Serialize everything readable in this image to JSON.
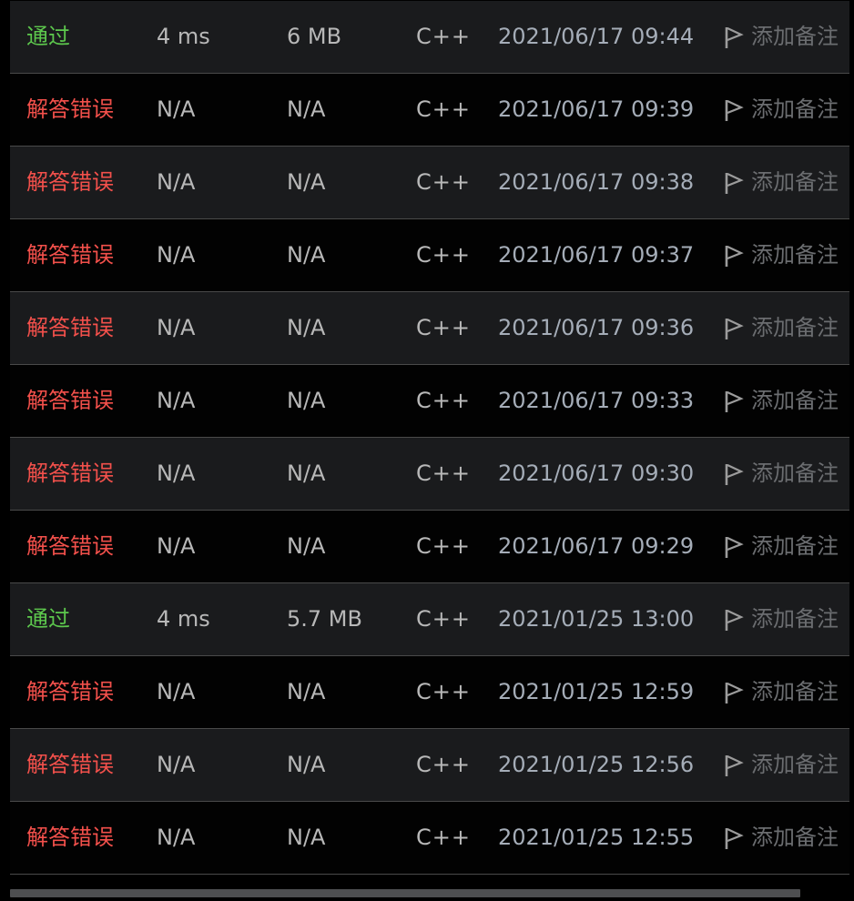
{
  "submissions": [
    {
      "status": "通过",
      "result": "pass",
      "runtime": "4 ms",
      "memory": "6 MB",
      "language": "C++",
      "time": "2021/06/17 09:44",
      "note": "添加备注"
    },
    {
      "status": "解答错误",
      "result": "fail",
      "runtime": "N/A",
      "memory": "N/A",
      "language": "C++",
      "time": "2021/06/17 09:39",
      "note": "添加备注"
    },
    {
      "status": "解答错误",
      "result": "fail",
      "runtime": "N/A",
      "memory": "N/A",
      "language": "C++",
      "time": "2021/06/17 09:38",
      "note": "添加备注"
    },
    {
      "status": "解答错误",
      "result": "fail",
      "runtime": "N/A",
      "memory": "N/A",
      "language": "C++",
      "time": "2021/06/17 09:37",
      "note": "添加备注"
    },
    {
      "status": "解答错误",
      "result": "fail",
      "runtime": "N/A",
      "memory": "N/A",
      "language": "C++",
      "time": "2021/06/17 09:36",
      "note": "添加备注"
    },
    {
      "status": "解答错误",
      "result": "fail",
      "runtime": "N/A",
      "memory": "N/A",
      "language": "C++",
      "time": "2021/06/17 09:33",
      "note": "添加备注"
    },
    {
      "status": "解答错误",
      "result": "fail",
      "runtime": "N/A",
      "memory": "N/A",
      "language": "C++",
      "time": "2021/06/17 09:30",
      "note": "添加备注"
    },
    {
      "status": "解答错误",
      "result": "fail",
      "runtime": "N/A",
      "memory": "N/A",
      "language": "C++",
      "time": "2021/06/17 09:29",
      "note": "添加备注"
    },
    {
      "status": "通过",
      "result": "pass",
      "runtime": "4 ms",
      "memory": "5.7 MB",
      "language": "C++",
      "time": "2021/01/25 13:00",
      "note": "添加备注"
    },
    {
      "status": "解答错误",
      "result": "fail",
      "runtime": "N/A",
      "memory": "N/A",
      "language": "C++",
      "time": "2021/01/25 12:59",
      "note": "添加备注"
    },
    {
      "status": "解答错误",
      "result": "fail",
      "runtime": "N/A",
      "memory": "N/A",
      "language": "C++",
      "time": "2021/01/25 12:56",
      "note": "添加备注"
    },
    {
      "status": "解答错误",
      "result": "fail",
      "runtime": "N/A",
      "memory": "N/A",
      "language": "C++",
      "time": "2021/01/25 12:55",
      "note": "添加备注"
    }
  ],
  "colors": {
    "pass": "#5dc84d",
    "fail": "#f2504b",
    "row_dark": "#1a1b1d",
    "row_black": "#020202",
    "divider": "#4a4a4a"
  },
  "icons": {
    "note": "flag-icon"
  }
}
